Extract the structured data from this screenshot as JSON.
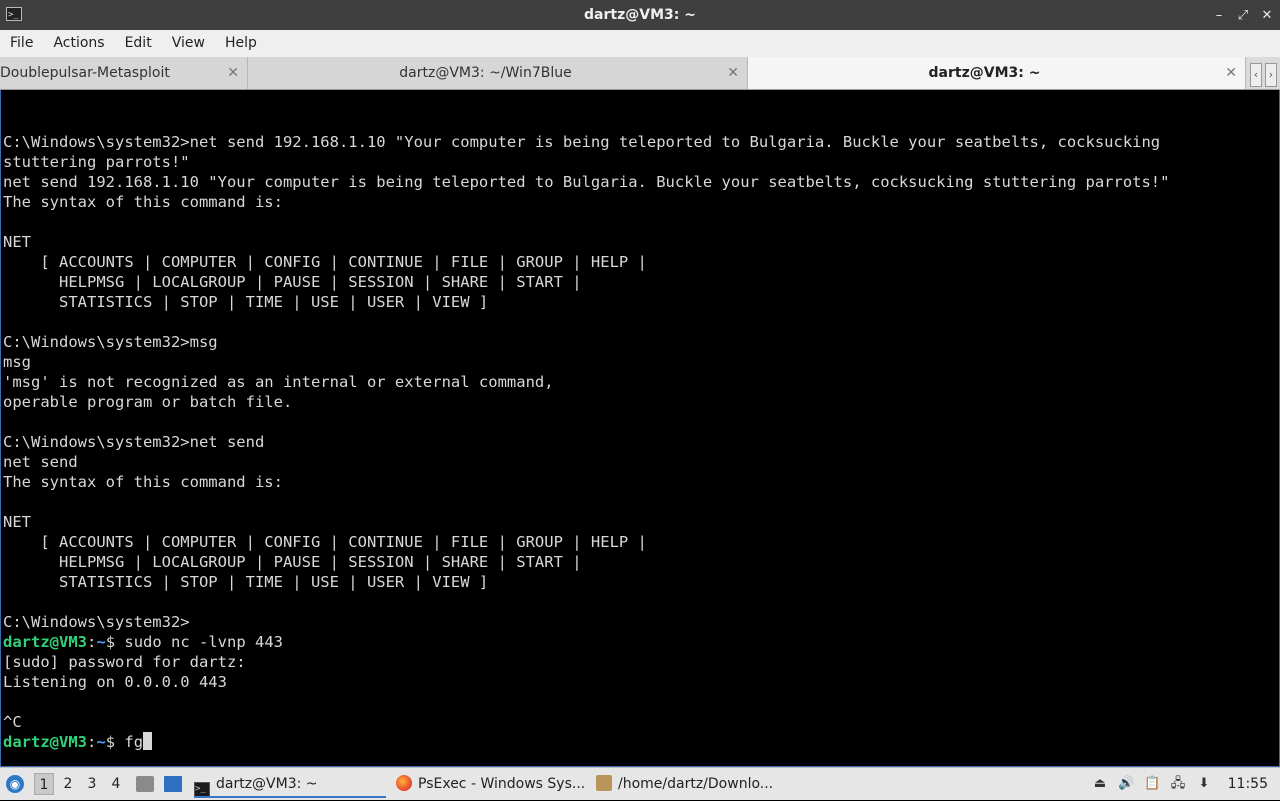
{
  "window": {
    "title": "dartz@VM3: ~",
    "controls": {
      "minimize": "–",
      "restore": "⤢",
      "close": "✕"
    }
  },
  "menu": [
    "File",
    "Actions",
    "Edit",
    "View",
    "Help"
  ],
  "tabs": [
    {
      "label": "Doublepulsar-Metasploit",
      "active": false
    },
    {
      "label": "dartz@VM3: ~/Win7Blue",
      "active": false
    },
    {
      "label": "dartz@VM3: ~",
      "active": true
    }
  ],
  "tab_scroll": {
    "left": "‹",
    "right": "›"
  },
  "terminal": {
    "lines": [
      "",
      "",
      "C:\\Windows\\system32>net send 192.168.1.10 \"Your computer is being teleported to Bulgaria. Buckle your seatbelts, cocksucking",
      "stuttering parrots!\"",
      "net send 192.168.1.10 \"Your computer is being teleported to Bulgaria. Buckle your seatbelts, cocksucking stuttering parrots!\"",
      "The syntax of this command is:",
      "",
      "NET",
      "    [ ACCOUNTS | COMPUTER | CONFIG | CONTINUE | FILE | GROUP | HELP |",
      "      HELPMSG | LOCALGROUP | PAUSE | SESSION | SHARE | START |",
      "      STATISTICS | STOP | TIME | USE | USER | VIEW ]",
      "",
      "C:\\Windows\\system32>msg",
      "msg",
      "'msg' is not recognized as an internal or external command,",
      "operable program or batch file.",
      "",
      "C:\\Windows\\system32>net send",
      "net send",
      "The syntax of this command is:",
      "",
      "NET",
      "    [ ACCOUNTS | COMPUTER | CONFIG | CONTINUE | FILE | GROUP | HELP |",
      "      HELPMSG | LOCALGROUP | PAUSE | SESSION | SHARE | START |",
      "      STATISTICS | STOP | TIME | USE | USER | VIEW ]",
      "",
      "C:\\Windows\\system32>"
    ],
    "prompt1": {
      "user": "dartz@VM3",
      "sep": ":",
      "dir": "~",
      "sym": "$ ",
      "cmd": "sudo nc -lvnp 443"
    },
    "after_lines": [
      "[sudo] password for dartz:",
      "Listening on 0.0.0.0 443",
      "",
      "^C"
    ],
    "prompt2": {
      "user": "dartz@VM3",
      "sep": ":",
      "dir": "~",
      "sym": "$ ",
      "cmd": "fg"
    }
  },
  "taskbar": {
    "start_icon": "lubuntu-start-icon",
    "workspaces": [
      "1",
      "2",
      "3",
      "4"
    ],
    "active_workspace": "1",
    "tasks": [
      {
        "label": "dartz@VM3: ~",
        "icon": "terminal-icon",
        "active": true
      },
      {
        "label": "PsExec - Windows Sys...",
        "icon": "firefox-icon",
        "active": false
      },
      {
        "label": "/home/dartz/Downlo...",
        "icon": "folder-icon",
        "active": false
      }
    ],
    "clock": "11:55"
  },
  "colors": {
    "prompt_user": "#33d17a",
    "prompt_dir": "#4aa0ff",
    "terminal_bg": "#000000",
    "terminal_fg": "#d8d8d8"
  }
}
